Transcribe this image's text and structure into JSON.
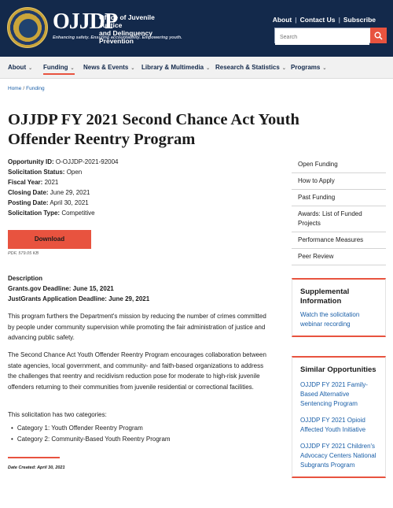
{
  "header": {
    "logo": "OJJDP",
    "office_line1": "Office of Juvenile Justice",
    "office_line2": "and Delinquency Prevention",
    "tagline": "Enhancing safety. Ensuring accountability. Empowering youth.",
    "links": [
      "About",
      "Contact Us",
      "Subscribe"
    ],
    "search_placeholder": "Search"
  },
  "nav": {
    "items": [
      "About",
      "Funding",
      "News & Events",
      "Library & Multimedia",
      "Research & Statistics",
      "Programs"
    ],
    "active": "Funding"
  },
  "breadcrumb": [
    "Home",
    "Funding"
  ],
  "page_title": "OJJDP FY 2021 Second Chance Act Youth Offender Reentry Program",
  "meta": [
    {
      "label": "Opportunity ID:",
      "value": "O-OJJDP-2021-92004"
    },
    {
      "label": "Solicitation Status:",
      "value": "Open"
    },
    {
      "label": "Fiscal Year:",
      "value": "2021"
    },
    {
      "label": "Closing Date:",
      "value": "June 29, 2021"
    },
    {
      "label": "Posting Date:",
      "value": "April 30, 2021"
    },
    {
      "label": "Solicitation Type:",
      "value": "Competitive"
    }
  ],
  "download": {
    "label": "Download",
    "file_info": "PDF, 579.05 KB"
  },
  "description": {
    "heading": "Description",
    "deadline1": "Grants.gov Deadline: June 15, 2021",
    "deadline2": "JustGrants Application Deadline: June 29, 2021",
    "para1": "This program furthers the Department's mission by reducing the number of crimes committed by people under community supervision while promoting the fair administration of justice and advancing public safety.",
    "para2": "The Second Chance Act Youth Offender Reentry Program encourages collaboration between state agencies, local government, and community- and faith-based organizations to address the challenges that reentry and recidivism reduction pose for moderate to high-risk juvenile offenders returning to their communities from juvenile residential or correctional facilities.",
    "para3": "This solicitation has two categories:",
    "categories": [
      "Category 1: Youth Offender Reentry Program",
      "Category 2: Community-Based Youth Reentry Program"
    ],
    "date_created": "Date Created: April 30, 2021"
  },
  "sidebar": {
    "items": [
      "Open Funding",
      "How to Apply",
      "Past Funding",
      "Awards: List of Funded Projects",
      "Performance Measures",
      "Peer Review"
    ],
    "supplemental": {
      "title": "Supplemental Information",
      "link": "Watch the solicitation webinar recording"
    },
    "similar": {
      "title": "Similar Opportunities",
      "links": [
        "OJJDP FY 2021 Family-Based Alternative Sentencing Program",
        "OJJDP FY 2021 Opioid Affected Youth Initiative",
        "OJJDP FY 2021 Children's Advocacy Centers National Subgrants Program"
      ]
    }
  },
  "colors": {
    "header_bg": "#13294b",
    "accent": "#e8533f",
    "link": "#1a5fa8"
  }
}
